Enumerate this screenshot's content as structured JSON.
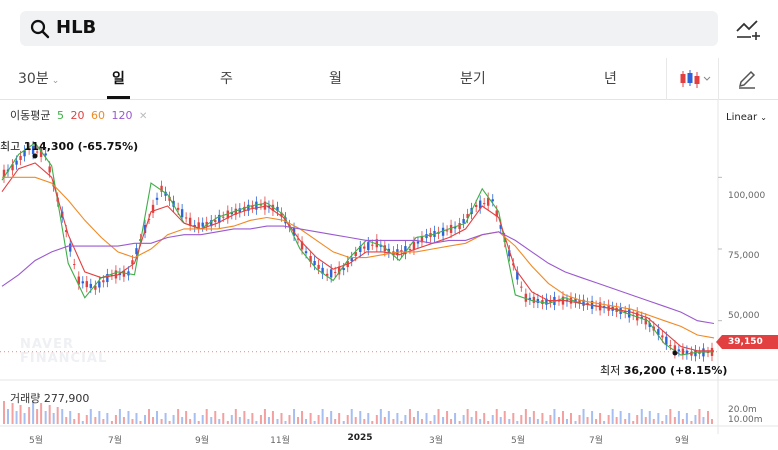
{
  "search": {
    "query": "HLB"
  },
  "tabs": [
    {
      "label": "30분",
      "active": false
    },
    {
      "label": "일",
      "active": true
    },
    {
      "label": "주",
      "active": false
    },
    {
      "label": "월",
      "active": false
    },
    {
      "label": "분기",
      "active": false
    },
    {
      "label": "년",
      "active": false
    }
  ],
  "legend": {
    "title": "이동평균",
    "ma": [
      "5",
      "20",
      "60",
      "120"
    ],
    "colors": [
      "#3fae49",
      "#e24040",
      "#f08a24",
      "#9b59d0"
    ]
  },
  "scale": "Linear",
  "volume": {
    "label": "거래량",
    "value": "277,900"
  },
  "annotations": {
    "high_prefix": "최고",
    "high": "114,300 (-65.75%)",
    "low_prefix": "최저",
    "low": "36,200 (+8.15%)"
  },
  "current_price": "39,150",
  "watermark": [
    "NAVER",
    "FINANCIAL"
  ],
  "yaxis": [
    "100,000",
    "75,000",
    "50,000"
  ],
  "vol_axis": [
    "20.0m",
    "10.00m"
  ],
  "xaxis": [
    "5월",
    "7월",
    "9월",
    "11월",
    "2025",
    "3월",
    "5월",
    "7월",
    "9월"
  ],
  "chart_data": {
    "type": "line",
    "title": "",
    "series": [
      {
        "name": "5",
        "color": "#3fae49",
        "values": [
          99000,
          108000,
          112000,
          104000,
          70000,
          58000,
          65000,
          67000,
          66000,
          98000,
          94000,
          84000,
          82000,
          86000,
          88000,
          90000,
          91000,
          87000,
          75000,
          68000,
          64000,
          72000,
          78000,
          76000,
          71000,
          79000,
          80000,
          82000,
          84000,
          96000,
          88000,
          59000,
          57000,
          56000,
          58000,
          56000,
          55000,
          54000,
          52000,
          50000,
          42000,
          38000,
          39000,
          39150
        ]
      },
      {
        "name": "20",
        "color": "#e24040",
        "values": [
          95000,
          103000,
          105000,
          100000,
          80000,
          67000,
          65000,
          66000,
          70000,
          88000,
          90000,
          84000,
          82000,
          84000,
          87000,
          89000,
          90000,
          86000,
          78000,
          72000,
          68000,
          70000,
          74000,
          74000,
          73000,
          75000,
          77000,
          79000,
          82000,
          90000,
          86000,
          68000,
          60000,
          57000,
          57000,
          56000,
          55000,
          54000,
          53000,
          51000,
          46000,
          41000,
          39500,
          39500
        ]
      },
      {
        "name": "60",
        "color": "#f08a24",
        "values": [
          100000,
          100000,
          100000,
          98000,
          92000,
          85000,
          79000,
          74000,
          72000,
          75000,
          80000,
          82000,
          82000,
          82000,
          83000,
          85000,
          86000,
          85000,
          82000,
          78000,
          74000,
          72000,
          72000,
          73000,
          74000,
          74000,
          75000,
          76000,
          77000,
          80000,
          81000,
          76000,
          69000,
          63000,
          59000,
          57000,
          56000,
          55000,
          54000,
          52000,
          50000,
          48000,
          45000,
          44000
        ]
      },
      {
        "name": "120",
        "color": "#9b59d0",
        "values": [
          62000,
          66000,
          71000,
          74000,
          76000,
          76000,
          76000,
          76000,
          77000,
          77000,
          79000,
          80000,
          80000,
          81000,
          82000,
          82000,
          83000,
          83000,
          82000,
          81000,
          80000,
          79000,
          78000,
          78000,
          78000,
          78000,
          77000,
          78000,
          78000,
          80000,
          81000,
          78000,
          74000,
          70000,
          67000,
          65000,
          63000,
          61000,
          59000,
          57000,
          55000,
          53000,
          50000,
          49000
        ]
      }
    ],
    "ylim": [
      30000,
      120000
    ],
    "grid": true,
    "legend": "top-left"
  }
}
